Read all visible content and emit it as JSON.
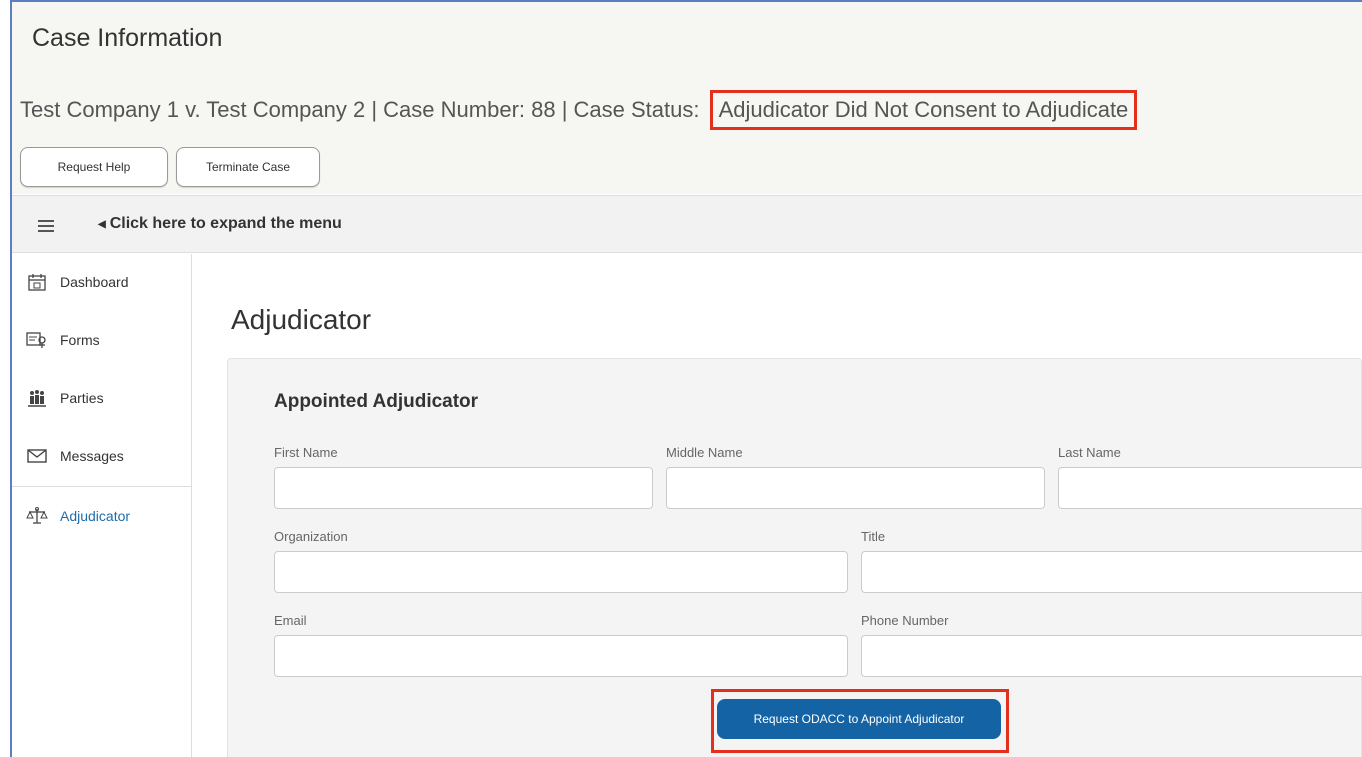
{
  "header": {
    "title": "Case Information",
    "subtitle_prefix": "Test Company 1 v. Test Company 2 | Case Number: 88 | Case Status:",
    "case_status": "Adjudicator Did Not Consent to Adjudicate",
    "request_help_label": "Request Help",
    "terminate_case_label": "Terminate Case"
  },
  "menu_bar": {
    "expand_label": "Click here to expand the menu"
  },
  "sidebar": {
    "items": [
      {
        "label": "Dashboard",
        "icon": "calendar-icon"
      },
      {
        "label": "Forms",
        "icon": "forms-icon"
      },
      {
        "label": "Parties",
        "icon": "parties-icon"
      },
      {
        "label": "Messages",
        "icon": "envelope-icon"
      },
      {
        "label": "Adjudicator",
        "icon": "scales-icon",
        "active": true
      }
    ]
  },
  "main": {
    "page_title": "Adjudicator",
    "card_title": "Appointed Adjudicator",
    "fields": {
      "first_name": {
        "label": "First Name",
        "value": ""
      },
      "middle_name": {
        "label": "Middle Name",
        "value": ""
      },
      "last_name": {
        "label": "Last Name",
        "value": ""
      },
      "organization": {
        "label": "Organization",
        "value": ""
      },
      "title": {
        "label": "Title",
        "value": ""
      },
      "email": {
        "label": "Email",
        "value": ""
      },
      "phone": {
        "label": "Phone Number",
        "value": ""
      }
    },
    "request_button_label": "Request ODACC to Appoint Adjudicator"
  },
  "colors": {
    "accent_blue": "#1464a5",
    "highlight_red": "#e3301c",
    "header_bg": "#f6f7f3"
  }
}
